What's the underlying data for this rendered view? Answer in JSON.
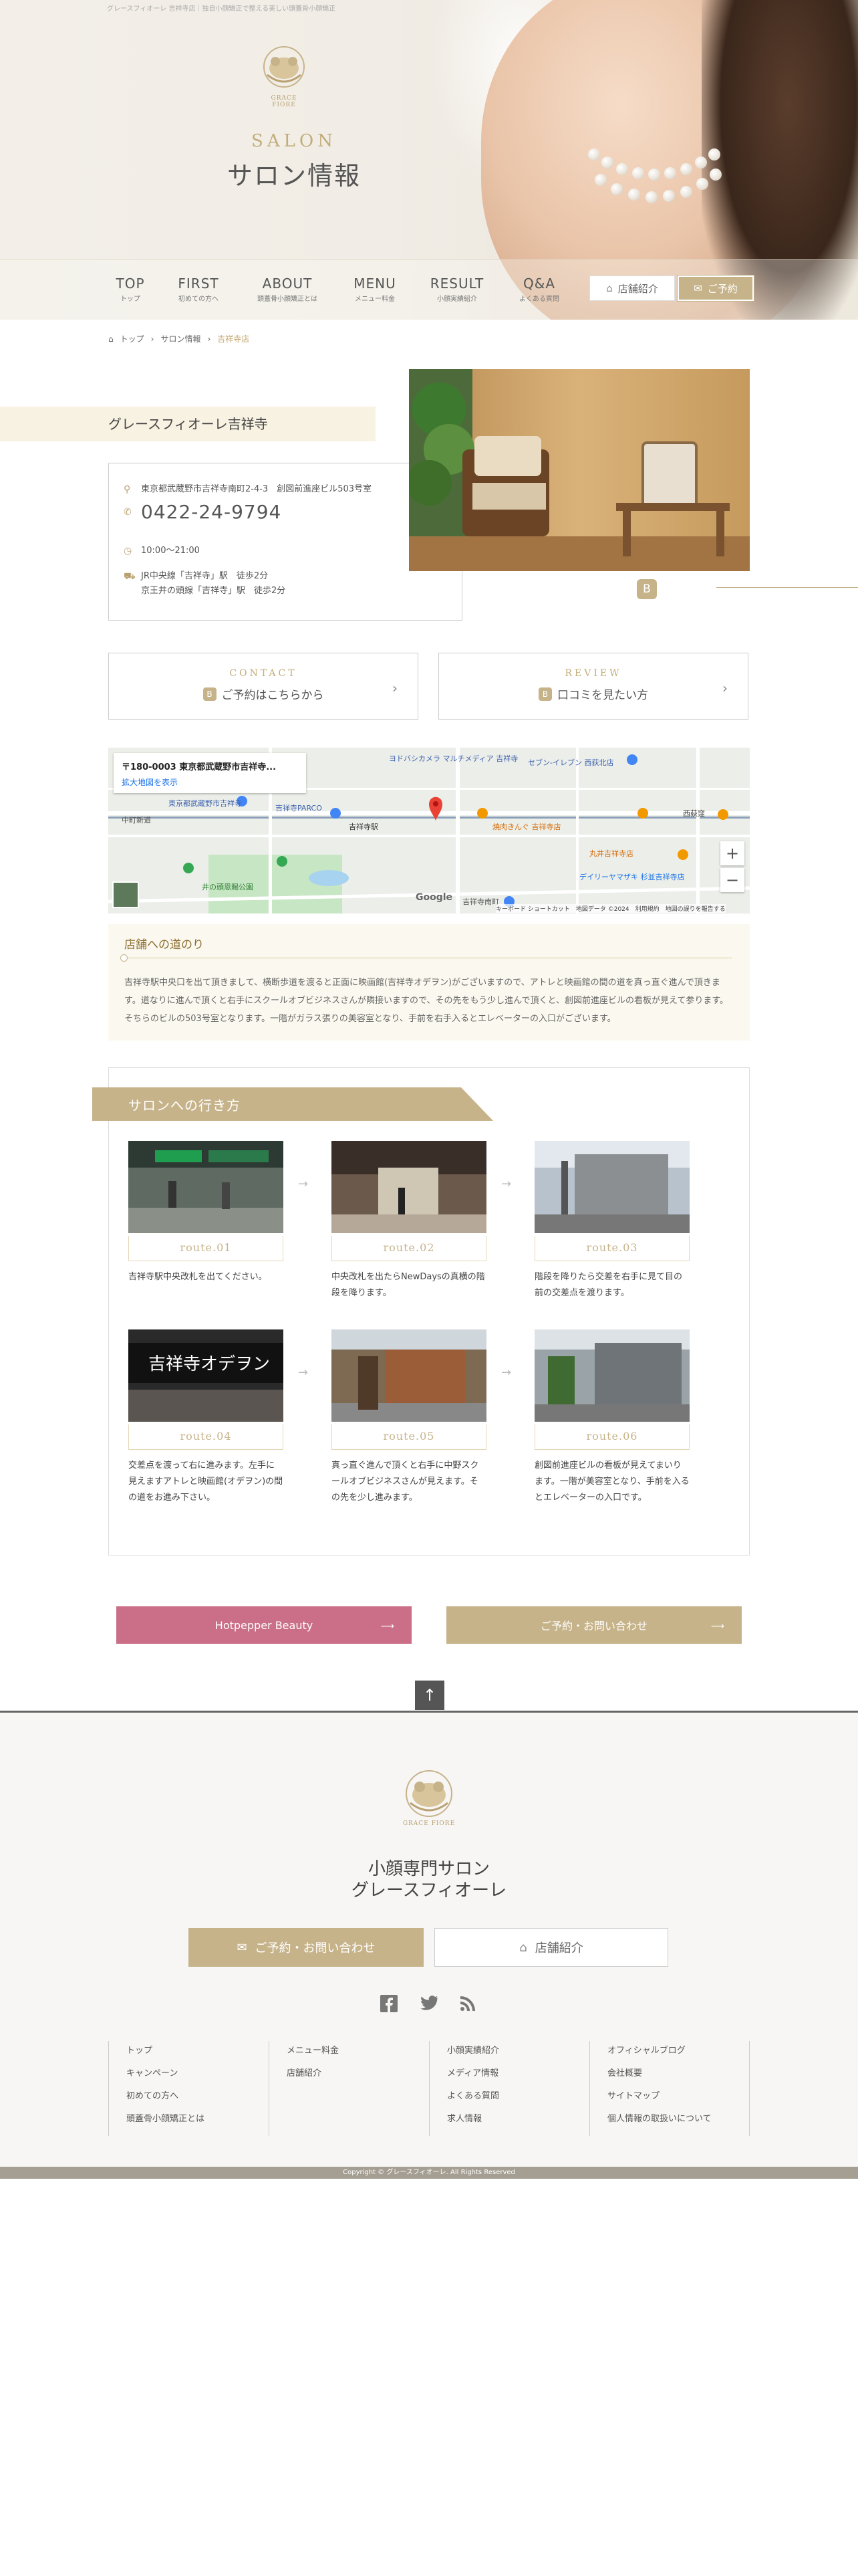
{
  "header": {
    "tagline": "グレースフィオーレ 吉祥寺店｜独自小顔矯正で整える美しい頭蓋骨小顔矯正",
    "logo_text": "GRACE FIORE",
    "title_en": "SALON",
    "title_ja": "サロン情報",
    "nav": [
      {
        "en": "TOP",
        "ja": "トップ"
      },
      {
        "en": "FIRST",
        "ja": "初めての方へ"
      },
      {
        "en": "ABOUT",
        "ja": "頭蓋骨小顔矯正とは"
      },
      {
        "en": "MENU",
        "ja": "メニュー料金"
      },
      {
        "en": "RESULT",
        "ja": "小顔実績紹介"
      },
      {
        "en": "Q&A",
        "ja": "よくある質問"
      }
    ],
    "shop_button": "店舗紹介",
    "reserve_button": "ご予約"
  },
  "breadcrumb": [
    "トップ",
    "サロン情報",
    "吉祥寺店"
  ],
  "salon": {
    "name": "グレースフィオーレ吉祥寺",
    "address": "東京都武蔵野市吉祥寺南町2-4-3　創図前進座ビル503号室",
    "phone": "0422-24-9794",
    "hours": "10:00〜21:00",
    "station1": "JR中央線「吉祥寺」駅　徒歩2分",
    "station2": "京王井の頭線「吉祥寺」駅　徒歩2分",
    "badge": "B"
  },
  "cta": {
    "contact_en": "CONTACT",
    "contact_ja": "ご予約はこちらから",
    "review_en": "REVIEW",
    "review_ja": "口コミを見たい方",
    "badge": "B"
  },
  "map": {
    "address": "〒180-0003 東京都武蔵野市吉祥寺...",
    "enlarge": "拡大地図を表示",
    "labels": [
      "東京都武蔵野市吉祥寺",
      "ヨドバシカメラ マルチメディア 吉祥寺",
      "セブン-イレブン 西荻北店",
      "吉祥寺PARCO",
      "吉祥寺駅",
      "焼肉きんぐ 吉祥寺店",
      "西荻窪",
      "丸井吉祥寺店",
      "井の頭恩賜公園",
      "デイリーヤマザキ 杉並吉祥寺店",
      "吉祥寺南町",
      "中町新道"
    ],
    "google": "Google",
    "footer": "キーボード ショートカット　地図データ ©2024　利用規約　地図の誤りを報告する"
  },
  "access": {
    "title": "店舗への道のり",
    "body": "吉祥寺駅中央口を出て頂きまして、横断歩道を渡ると正面に映画館(吉祥寺オデヲン)がございますので、アトレと映画館の間の道を真っ直ぐ進んで頂きます。道なりに進んで頂くと右手にスクールオブビジネスさんが隣接いますので、その先をもう少し進んで頂くと、創図前進座ビルの看板が見えて参ります。そちらのビルの503号室となります。一階がガラス張りの美容室となり、手前を右手入るとエレベーターの入口がございます。"
  },
  "route": {
    "title": "サロンへの行き方",
    "steps": [
      {
        "label": "route.01",
        "caption": "吉祥寺駅中央改札を出てください。"
      },
      {
        "label": "route.02",
        "caption": "中央改札を出たらNewDaysの真横の階段を降ります。"
      },
      {
        "label": "route.03",
        "caption": "階段を降りたら交差を右手に見て目の前の交差点を渡ります。"
      },
      {
        "label": "route.04",
        "caption": "交差点を渡って右に進みます。左手に見えますアトレと映画館(オデヲン)の間の道をお進み下さい。"
      },
      {
        "label": "route.05",
        "caption": "真っ直ぐ進んで頂くと右手に中野スクールオブビジネスさんが見えます。その先を少し進みます。"
      },
      {
        "label": "route.06",
        "caption": "創図前進座ビルの看板が見えてまいります。一階が美容室となり、手前を入るとエレベーターの入口です。"
      }
    ]
  },
  "buttons": {
    "hotpepper": "Hotpepper Beauty",
    "contact": "ご予約・お問い合わせ"
  },
  "footer": {
    "logo_text": "GRACE FIORE",
    "name1": "小顔専門サロン",
    "name2": "グレースフィオーレ",
    "btn_contact": "ご予約・お問い合わせ",
    "btn_shop": "店舗紹介",
    "cols": [
      [
        "トップ",
        "キャンペーン",
        "初めての方へ",
        "頭蓋骨小顔矯正とは"
      ],
      [
        "メニュー料金",
        "店舗紹介"
      ],
      [
        "小顔実績紹介",
        "メディア情報",
        "よくある質問",
        "求人情報"
      ],
      [
        "オフィシャルブログ",
        "会社概要",
        "サイトマップ",
        "個人情報の取扱いについて"
      ]
    ],
    "copyright": "Copyright © グレースフィオーレ. All Rights Reserved"
  },
  "colors": {
    "gold": "#c6b38a",
    "pink": "#cb6e88",
    "dark": "#555555"
  },
  "icons": [
    "home-icon",
    "mail-icon",
    "pin-icon",
    "phone-icon",
    "clock-icon",
    "train-icon",
    "facebook-icon",
    "twitter-icon",
    "rss-icon",
    "arrow-up-icon"
  ]
}
